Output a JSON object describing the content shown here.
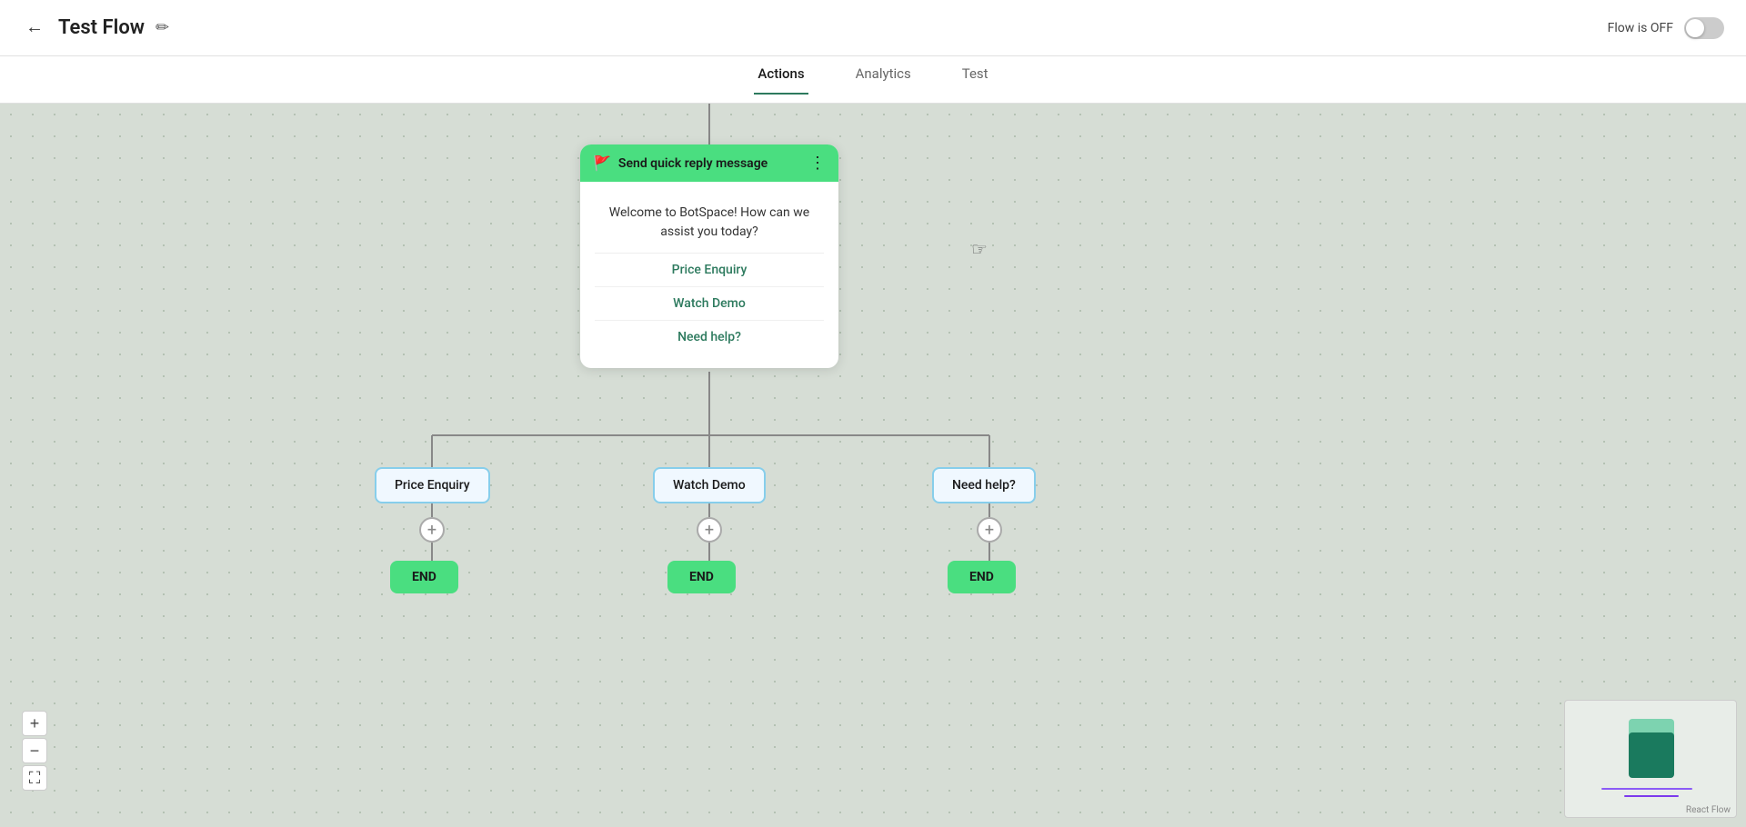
{
  "header": {
    "title": "Test Flow",
    "back_label": "←",
    "edit_icon": "✏",
    "flow_status_label": "Flow is OFF",
    "toggle_state": "off"
  },
  "tabs": {
    "items": [
      {
        "id": "actions",
        "label": "Actions",
        "active": true
      },
      {
        "id": "analytics",
        "label": "Analytics",
        "active": false
      },
      {
        "id": "test",
        "label": "Test",
        "active": false
      }
    ]
  },
  "flow": {
    "main_node": {
      "header_title": "Send quick reply message",
      "message": "Welcome to BotSpace! How can we assist you today?",
      "options": [
        {
          "label": "Price Enquiry"
        },
        {
          "label": "Watch Demo"
        },
        {
          "label": "Need help?"
        }
      ]
    },
    "branch_nodes": [
      {
        "id": "price-enquiry",
        "label": "Price Enquiry"
      },
      {
        "id": "watch-demo",
        "label": "Watch Demo"
      },
      {
        "id": "need-help",
        "label": "Need help?"
      }
    ],
    "end_label": "END",
    "plus_label": "+"
  },
  "zoom": {
    "plus_label": "+",
    "minus_label": "−",
    "fit_label": "⛶"
  },
  "minimap": {
    "label": "React Flow"
  }
}
